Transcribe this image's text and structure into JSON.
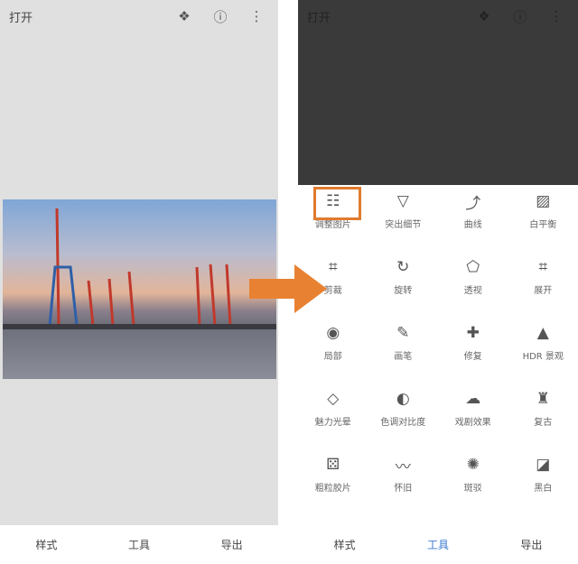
{
  "left": {
    "title": "打开",
    "icons": [
      "layers-icon",
      "info-icon",
      "more-vert-icon"
    ]
  },
  "right": {
    "title": "打开",
    "icons": [
      "layers-icon",
      "info-icon",
      "more-vert-icon"
    ]
  },
  "tools": [
    {
      "label": "调整图片",
      "icon": "tune-icon",
      "g": "☷"
    },
    {
      "label": "突出细节",
      "icon": "details-icon",
      "g": "▽"
    },
    {
      "label": "曲线",
      "icon": "curves-icon",
      "g": "⤴"
    },
    {
      "label": "白平衡",
      "icon": "white-balance-icon",
      "g": "▨"
    },
    {
      "label": "剪裁",
      "icon": "crop-icon",
      "g": "⌗"
    },
    {
      "label": "旋转",
      "icon": "rotate-icon",
      "g": "↻"
    },
    {
      "label": "透视",
      "icon": "perspective-icon",
      "g": "⬠"
    },
    {
      "label": "展开",
      "icon": "expand-icon",
      "g": "⌗"
    },
    {
      "label": "局部",
      "icon": "selective-icon",
      "g": "◉"
    },
    {
      "label": "画笔",
      "icon": "brush-icon",
      "g": "✎"
    },
    {
      "label": "修复",
      "icon": "healing-icon",
      "g": "✚"
    },
    {
      "label": "HDR 景观",
      "icon": "hdr-icon",
      "g": "▲"
    },
    {
      "label": "魅力光晕",
      "icon": "glamour-glow-icon",
      "g": "◇"
    },
    {
      "label": "色调对比度",
      "icon": "tonal-contrast-icon",
      "g": "◐"
    },
    {
      "label": "戏剧效果",
      "icon": "drama-icon",
      "g": "☁"
    },
    {
      "label": "复古",
      "icon": "vintage-icon",
      "g": "♜"
    },
    {
      "label": "粗粒胶片",
      "icon": "grainy-film-icon",
      "g": "⚄"
    },
    {
      "label": "怀旧",
      "icon": "retrolux-icon",
      "g": "〰"
    },
    {
      "label": "斑驳",
      "icon": "grunge-icon",
      "g": "✺"
    },
    {
      "label": "黑白",
      "icon": "black-white-icon",
      "g": "◪"
    }
  ],
  "bottom": {
    "styles": "样式",
    "tools": "工具",
    "export": "导出"
  },
  "colors": {
    "accent": "#3b7bd1",
    "highlight": "#e07b2e"
  }
}
